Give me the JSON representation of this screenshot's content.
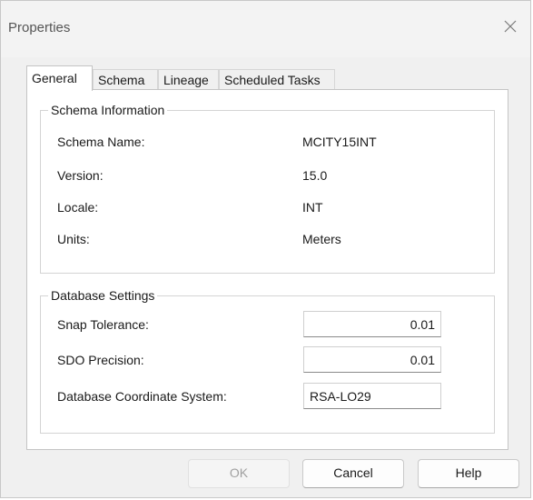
{
  "window": {
    "title": "Properties",
    "close_icon": "close-icon"
  },
  "tabs": [
    {
      "label": "General",
      "active": true
    },
    {
      "label": "Schema",
      "active": false
    },
    {
      "label": "Lineage",
      "active": false
    },
    {
      "label": "Scheduled Tasks",
      "active": false
    }
  ],
  "schema_info": {
    "title": "Schema Information",
    "rows": [
      {
        "label": "Schema Name:",
        "value": "MCITY15INT"
      },
      {
        "label": "Version:",
        "value": "15.0"
      },
      {
        "label": "Locale:",
        "value": "INT"
      },
      {
        "label": "Units:",
        "value": "Meters"
      }
    ]
  },
  "db_settings": {
    "title": "Database Settings",
    "snap_tolerance": {
      "label": "Snap Tolerance:",
      "value": "0.01"
    },
    "sdo_precision": {
      "label": "SDO Precision:",
      "value": "0.01"
    },
    "coord_system": {
      "label": "Database Coordinate System:",
      "value": "RSA-LO29"
    }
  },
  "buttons": {
    "ok": "OK",
    "cancel": "Cancel",
    "help": "Help"
  }
}
